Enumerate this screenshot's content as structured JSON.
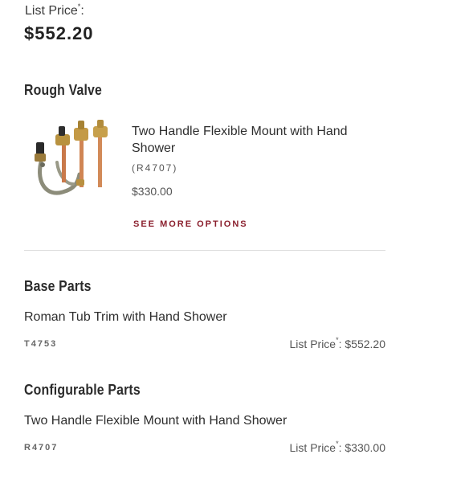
{
  "header": {
    "list_price_label": "List Price",
    "asterisk": "*",
    "colon": ":",
    "price": "$552.20"
  },
  "rough_valve": {
    "heading": "Rough Valve",
    "product": {
      "title": "Two Handle Flexible Mount with Hand Shower",
      "code": "(R4707)",
      "price": "$330.00",
      "image_icon": "valve-product-image"
    },
    "see_more_label": "SEE MORE OPTIONS"
  },
  "base_parts": {
    "heading": "Base Parts",
    "item": {
      "name": "Roman Tub Trim with Hand Shower",
      "code": "T4753",
      "list_price_label": "List Price",
      "asterisk": "*",
      "price": ": $552.20"
    }
  },
  "configurable_parts": {
    "heading": "Configurable Parts",
    "item": {
      "name": "Two Handle Flexible Mount with Hand Shower",
      "code": "R4707",
      "list_price_label": "List Price",
      "asterisk": "*",
      "price": ": $330.00"
    }
  },
  "colors": {
    "accent": "#8a1f2d",
    "text": "#333333",
    "divider": "#dddddd"
  }
}
